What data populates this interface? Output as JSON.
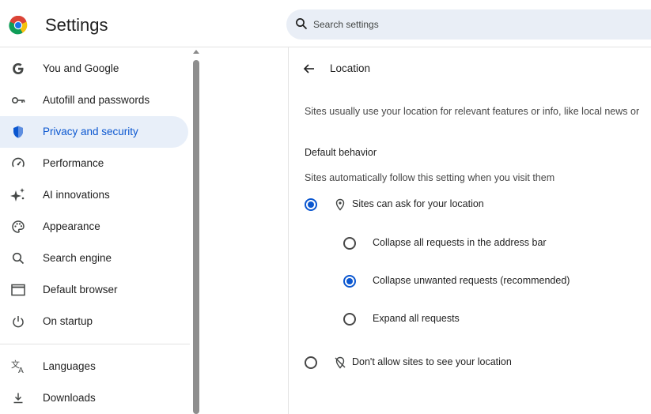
{
  "header": {
    "title": "Settings",
    "search_placeholder": "Search settings"
  },
  "sidebar": {
    "items": [
      {
        "label": "You and Google",
        "icon": "google-g-icon"
      },
      {
        "label": "Autofill and passwords",
        "icon": "key-icon"
      },
      {
        "label": "Privacy and security",
        "icon": "shield-icon",
        "active": true
      },
      {
        "label": "Performance",
        "icon": "speedometer-icon"
      },
      {
        "label": "AI innovations",
        "icon": "sparkle-icon"
      },
      {
        "label": "Appearance",
        "icon": "palette-icon"
      },
      {
        "label": "Search engine",
        "icon": "search-icon"
      },
      {
        "label": "Default browser",
        "icon": "browser-window-icon"
      },
      {
        "label": "On startup",
        "icon": "power-icon"
      },
      {
        "label": "Languages",
        "icon": "translate-icon"
      },
      {
        "label": "Downloads",
        "icon": "download-icon"
      }
    ]
  },
  "location_page": {
    "title": "Location",
    "description": "Sites usually use your location for relevant features or info, like local news or",
    "default_behavior": {
      "heading": "Default behavior",
      "subtitle": "Sites automatically follow this setting when you visit them",
      "allow_option": "Sites can ask for your location",
      "sub_options": [
        "Collapse all requests in the address bar",
        "Collapse unwanted requests (recommended)",
        "Expand all requests"
      ],
      "block_option": "Don't allow sites to see your location"
    }
  },
  "colors": {
    "accent": "#0b57d0",
    "active_nav_bg": "#e8eff9",
    "search_bg": "#e9eef6"
  }
}
